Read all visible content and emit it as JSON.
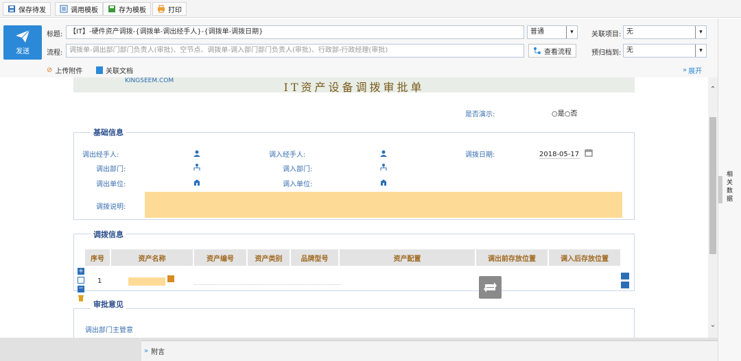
{
  "toolbar": {
    "save_draft": "保存待发",
    "use_template": "调用模板",
    "save_template": "存为模板",
    "print": "打印"
  },
  "header": {
    "send_label": "发送",
    "title_label": "标题:",
    "title_value": "【IT】-硬件资产调拨-{调拨单-调出经手人}-{调拨单-调拨日期}",
    "flow_label": "流程:",
    "flow_value": "调拨单-调出部门部门负责人(审批)、空节点、调拨单-调入部门部门负责人(审批)、行政部-行政经理(审批)",
    "priority_value": "普通",
    "view_flow": "查看流程",
    "related_project_label": "关联项目:",
    "related_project_value": "无",
    "archive_label": "预归档到:",
    "archive_value": "无",
    "upload_attachment": "上传附件",
    "related_doc": "关联文档",
    "expand": "展开"
  },
  "side_panel": {
    "label": "相关数据"
  },
  "form": {
    "logo_text": "KINGSEEM.COM",
    "title": "IT资产设备调拨审批单",
    "demo_label": "是否演示:",
    "demo_options": "○是○否",
    "basic_section": "基础信息",
    "out_handler_label": "调出经手人:",
    "in_handler_label": "调入经手人:",
    "transfer_date_label": "调拨日期:",
    "transfer_date_value": "2018-05-17",
    "out_dept_label": "调出部门:",
    "in_dept_label": "调入部门:",
    "out_unit_label": "调出单位:",
    "in_unit_label": "调入单位:",
    "transfer_note_label": "调拨说明:",
    "transfer_section": "调拨信息",
    "columns": [
      "序号",
      "资产名称",
      "资产编号",
      "资产类别",
      "品牌型号",
      "资产配置",
      "调出前存放位置",
      "调入后存放位置"
    ],
    "row_index": "1",
    "approval_section": "审批意见",
    "out_dept_manager_label": "调出部门主管意"
  },
  "bottom": {
    "postscript": "附言"
  },
  "colors": {
    "accent": "#2c89d8",
    "section": "#2b4e8c",
    "header_text": "#a06a22",
    "highlight": "#fddb97"
  }
}
